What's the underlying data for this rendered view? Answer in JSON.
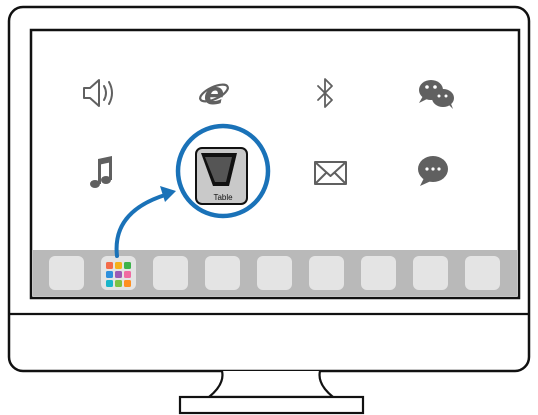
{
  "colors": {
    "frame": "#111111",
    "screen_bg": "#ffffff",
    "dock_bg": "#b9b9b9",
    "dock_tile": "#e4e4e4",
    "icon_gray": "#606060",
    "highlight": "#1a72b8",
    "app_tile_bg": "#c9c9c9",
    "grid_colors": [
      "#f36b4a",
      "#f5b11b",
      "#3cb34a",
      "#2e8fdc",
      "#9b59b6",
      "#f06aa2",
      "#19b5c9",
      "#7cc243",
      "#ff8f1f"
    ]
  },
  "apps": [
    {
      "name": "speaker-icon",
      "label": ""
    },
    {
      "name": "internet-explorer-icon",
      "label": ""
    },
    {
      "name": "bluetooth-icon",
      "label": ""
    },
    {
      "name": "wechat-icon",
      "label": ""
    },
    {
      "name": "music-note-icon",
      "label": ""
    },
    {
      "name": "tablet-icon",
      "label": "Table"
    },
    {
      "name": "mail-icon",
      "label": ""
    },
    {
      "name": "chat-bubble-icon",
      "label": ""
    }
  ],
  "dock": {
    "launcher_icon": "app-grid-icon",
    "slots": 9
  }
}
